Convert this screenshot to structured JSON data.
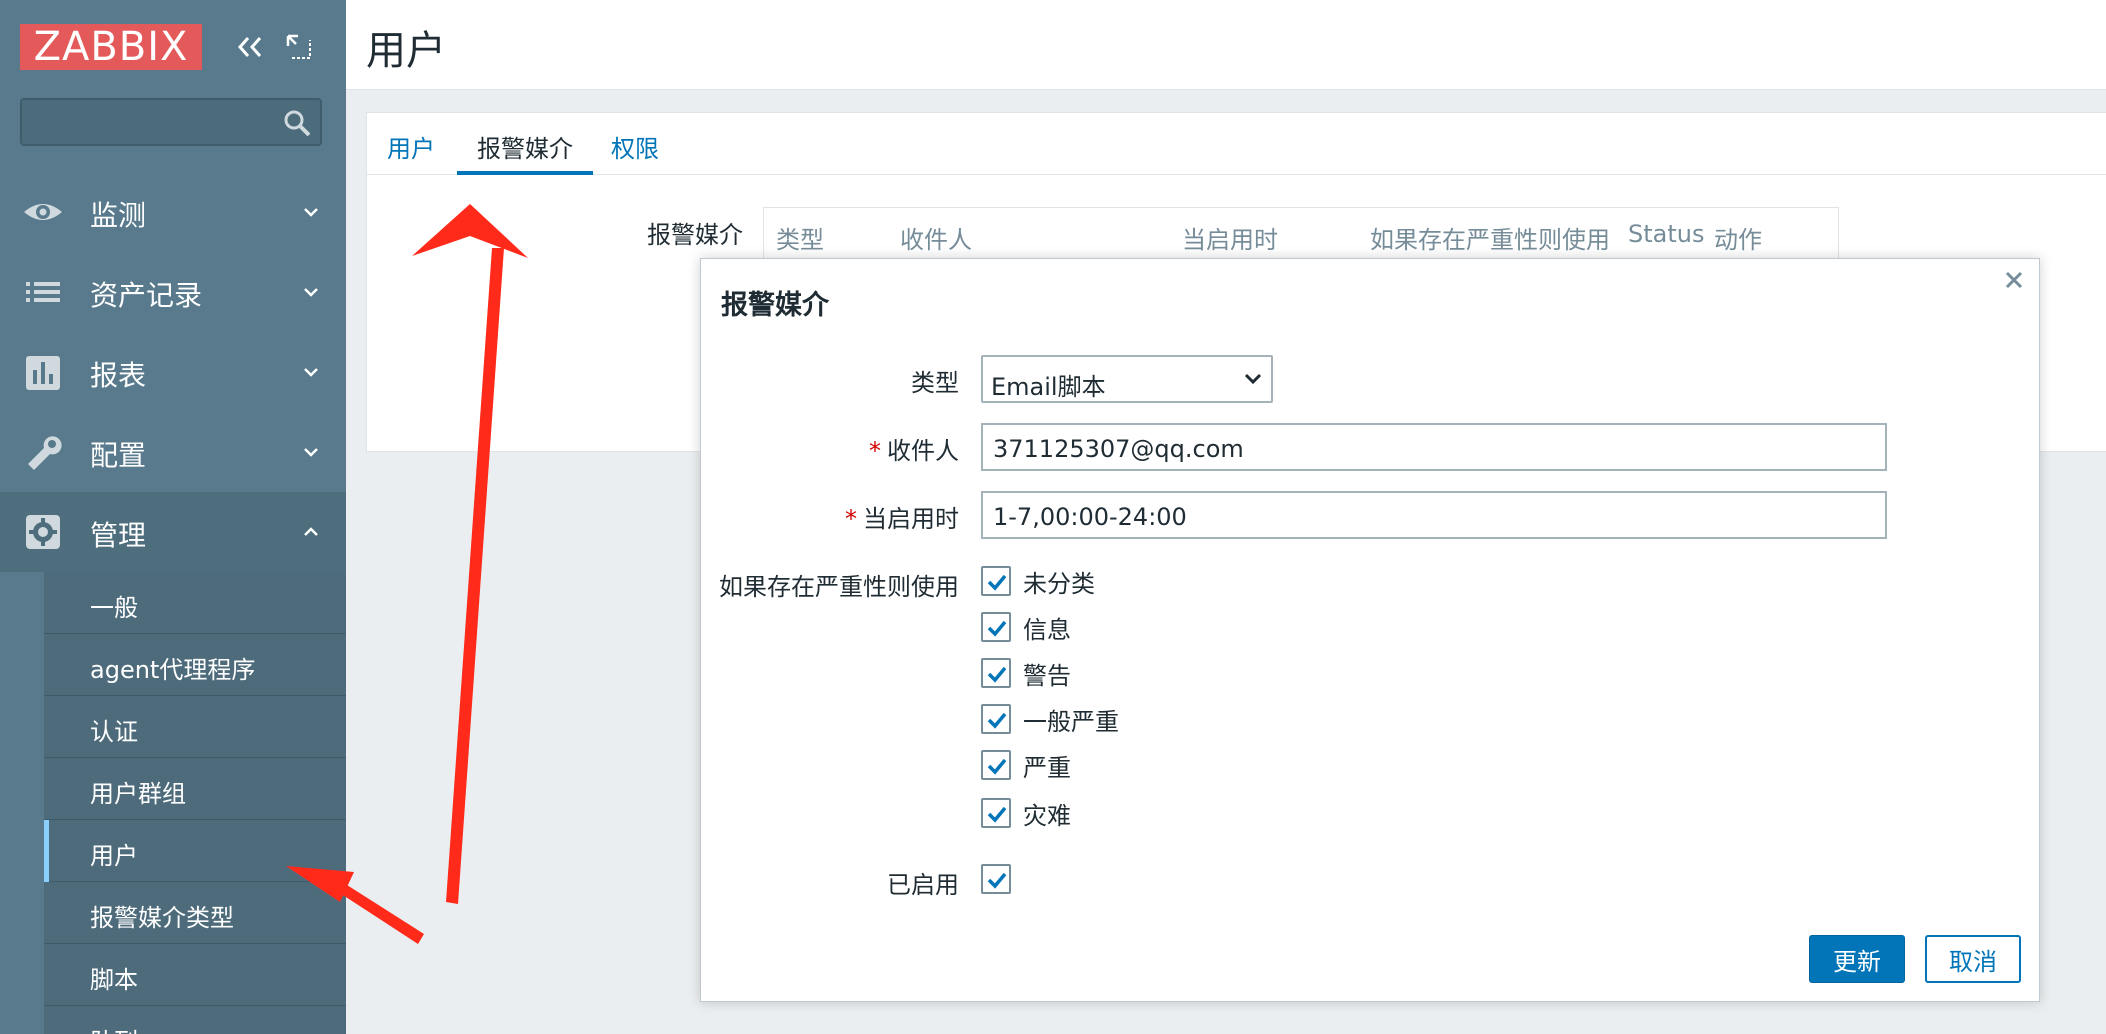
{
  "app": {
    "logo": "ZABBIX"
  },
  "sidebar": {
    "search_placeholder": "",
    "menu": [
      {
        "label": "监测",
        "icon": "eye-icon"
      },
      {
        "label": "资产记录",
        "icon": "list-icon"
      },
      {
        "label": "报表",
        "icon": "bar-chart-icon"
      },
      {
        "label": "配置",
        "icon": "wrench-icon"
      },
      {
        "label": "管理",
        "icon": "gear-icon"
      }
    ],
    "submenu": [
      {
        "label": "一般"
      },
      {
        "label": "agent代理程序"
      },
      {
        "label": "认证"
      },
      {
        "label": "用户群组"
      },
      {
        "label": "用户",
        "selected": true
      },
      {
        "label": "报警媒介类型"
      },
      {
        "label": "脚本"
      },
      {
        "label": "队列"
      }
    ]
  },
  "page": {
    "title": "用户",
    "tabs": [
      {
        "label": "用户"
      },
      {
        "label": "报警媒介",
        "active": true
      },
      {
        "label": "权限"
      }
    ],
    "media_section_label": "报警媒介",
    "media_table_headers": [
      "类型",
      "收件人",
      "当启用时",
      "如果存在严重性则使用",
      "Status",
      "动作"
    ]
  },
  "modal": {
    "title": "报警媒介",
    "type_label": "类型",
    "type_value": "Email脚本",
    "sendto_label": "收件人",
    "sendto_value": "371125307@qq.com",
    "period_label": "当启用时",
    "period_value": "1-7,00:00-24:00",
    "severity_label": "如果存在严重性则使用",
    "severities": [
      {
        "label": "未分类",
        "checked": true
      },
      {
        "label": "信息",
        "checked": true
      },
      {
        "label": "警告",
        "checked": true
      },
      {
        "label": "一般严重",
        "checked": true
      },
      {
        "label": "严重",
        "checked": true
      },
      {
        "label": "灾难",
        "checked": true
      }
    ],
    "enabled_label": "已启用",
    "enabled": true,
    "update_button": "更新",
    "cancel_button": "取消"
  },
  "colors": {
    "sidebar": "#587a8c",
    "accent": "#0275b8",
    "logo_bg": "#e45959",
    "annotation_arrow": "#ff2a1a"
  }
}
